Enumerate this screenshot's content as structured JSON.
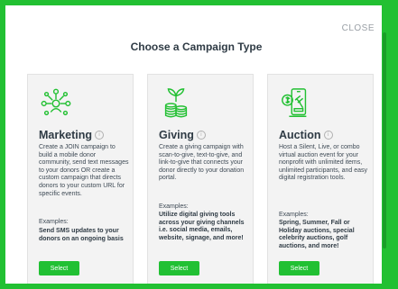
{
  "modal": {
    "close_label": "CLOSE",
    "title": "Choose a Campaign Type"
  },
  "cards": [
    {
      "icon": "network-people-icon",
      "title": "Marketing",
      "description": "Create a JOIN campaign to build a mobile donor community, send text messages to your donors OR create a custom campaign that directs donors to your custom URL for specific events.",
      "examples_label": "Examples:",
      "examples": "Send SMS updates to your donors on an ongoing basis",
      "button_label": "Select"
    },
    {
      "icon": "plant-coins-icon",
      "title": "Giving",
      "description": "Create a giving campaign with scan-to-give, text-to-give, and link-to-give that connects your donor directly to your donation portal.",
      "examples_label": "Examples:",
      "examples": "Utilize digital giving tools across your giving channels i.e. social media, emails, website, signage, and more!",
      "button_label": "Select"
    },
    {
      "icon": "mobile-auction-icon",
      "title": "Auction",
      "description": "Host a Silent, Live, or combo virtual auction event for your nonprofit with unlimited items, unlimited participants, and easy digital registration tools.",
      "examples_label": "Examples:",
      "examples": "Spring, Summer, Fall or Holiday auctions, special celebrity auctions, golf auctions, and more!",
      "button_label": "Select"
    }
  ],
  "colors": {
    "accent": "#21c033",
    "frame": "#22c032",
    "title": "#2f3b45"
  }
}
